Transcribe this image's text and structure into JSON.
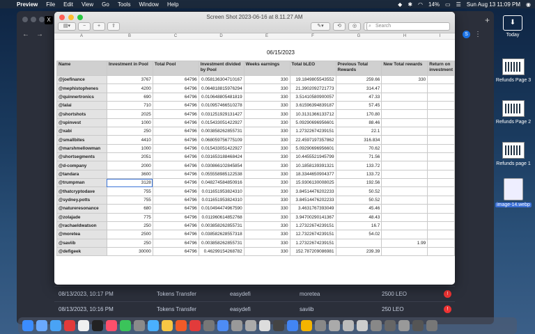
{
  "menubar": {
    "app": "Preview",
    "items": [
      "File",
      "Edit",
      "View",
      "Go",
      "Tools",
      "Window",
      "Help"
    ],
    "battery": "14%",
    "datetime": "Sun Aug 13  11:09 PM"
  },
  "window": {
    "title": "Screen Shot 2023-06-16 at 8.11.27 AM",
    "search_placeholder": "Search"
  },
  "sheet": {
    "columns": [
      "A",
      "B",
      "C",
      "D",
      "E",
      "F",
      "G",
      "H",
      "I"
    ],
    "date": "06/15/2023",
    "headers": [
      "Name",
      "Investment in Pool",
      "Total Pool",
      "Investment divided by Pool",
      "Weeks earnings",
      "Total bLEO",
      "Previous Total Rewards",
      "New Total rewards",
      "Return on investment"
    ],
    "rows": [
      [
        "@joefinance",
        "3767",
        "64796",
        "0.058136304710167",
        "330",
        "19.1849805543552",
        "259.66",
        "330",
        ""
      ],
      [
        "@mephistophenes",
        "4200",
        "64796",
        "0.064818815976294",
        "330",
        "21.3902092721773",
        "314.47",
        "",
        ""
      ],
      [
        "@quinnertronics",
        "690",
        "64796",
        "0.010648805481819",
        "330",
        "3.51410580900057",
        "47.33",
        "",
        ""
      ],
      [
        "@lalai",
        "710",
        "64796",
        "0.010957466510278",
        "330",
        "3.61596394839187",
        "57.45",
        "",
        ""
      ],
      [
        "@shortshots",
        "2025",
        "64796",
        "0.031251929131427",
        "330",
        "10.3131366133712",
        "170.80",
        "",
        ""
      ],
      [
        "@spinvest",
        "1000",
        "64796",
        "0.015433051422927",
        "330",
        "5.09290696956601",
        "88.46",
        "",
        ""
      ],
      [
        "@xabi",
        "250",
        "64796",
        "0.003858262855731",
        "330",
        "1.27322674239151",
        "22.1",
        "",
        ""
      ],
      [
        "@smallbites",
        "4410",
        "64796",
        "0.068059756775109",
        "330",
        "22.4597197357862",
        "316.834",
        "",
        ""
      ],
      [
        "@marshmellowman",
        "1000",
        "64796",
        "0.015433051422927",
        "330",
        "5.09290696956601",
        "70.62",
        "",
        ""
      ],
      [
        "@shortsegments",
        "2051",
        "64796",
        "0.031653188468424",
        "330",
        "10.4455521945799",
        "71.56",
        "",
        ""
      ],
      [
        "@d-company",
        "2000",
        "64796",
        "0.030866102845854",
        "330",
        "10.1858139391321",
        "133.72",
        "",
        ""
      ],
      [
        "@tandara",
        "3600",
        "64796",
        "0.055558985122538",
        "330",
        "18.3344650904377",
        "133.72",
        "",
        ""
      ],
      [
        "@trumpman",
        "3128",
        "64796",
        "0.048274584850916",
        "330",
        "15.9306130008025",
        "192.56",
        "",
        ""
      ],
      [
        "@thatcryptodave",
        "755",
        "64796",
        "0.011651953824310",
        "330",
        "3.84514476202233",
        "50.52",
        "",
        ""
      ],
      [
        "@sydney.potts",
        "755",
        "64796",
        "0.011651953824310",
        "330",
        "3.84514476202233",
        "50.52",
        "",
        ""
      ],
      [
        "@natureresonance",
        "680",
        "64796",
        "0.010494474967590",
        "330",
        "3.4631767393049",
        "45.46",
        "",
        ""
      ],
      [
        "@zolajade",
        "775",
        "64796",
        "0.011960614852768",
        "330",
        "3.94700290141367",
        "48.43",
        "",
        ""
      ],
      [
        "@rachaeldwatson",
        "250",
        "64796",
        "0.003858262855731",
        "330",
        "1.27322674239151",
        "16.7",
        "",
        ""
      ],
      [
        "@moretea",
        "2500",
        "64796",
        "0.038582628557318",
        "330",
        "12.7322674239151",
        "54.02",
        "",
        ""
      ],
      [
        "@saviib",
        "250",
        "64796",
        "0.003858262855731",
        "330",
        "1.27322674239151",
        "",
        "1.99",
        ""
      ],
      [
        "@defigeek",
        "30000",
        "64796",
        "0.46299154268782",
        "330",
        "152.787209086981",
        "239.39",
        "",
        ""
      ]
    ]
  },
  "transactions": [
    {
      "date": "08/13/2023, 10:17 PM",
      "type": "Tokens Transfer",
      "from": "easydefi",
      "to": "moretea",
      "amount": "2500 LEO"
    },
    {
      "date": "08/13/2023, 10:16 PM",
      "type": "Tokens Transfer",
      "from": "easydefi",
      "to": "saviib",
      "amount": "250 LEO"
    }
  ],
  "desktop": {
    "items": [
      {
        "label": "Today"
      },
      {
        "label": "Refunds Page 3"
      },
      {
        "label": "Refunds Page 2"
      },
      {
        "label": "Refunds page 1"
      },
      {
        "label": "image-14.webp"
      }
    ]
  }
}
